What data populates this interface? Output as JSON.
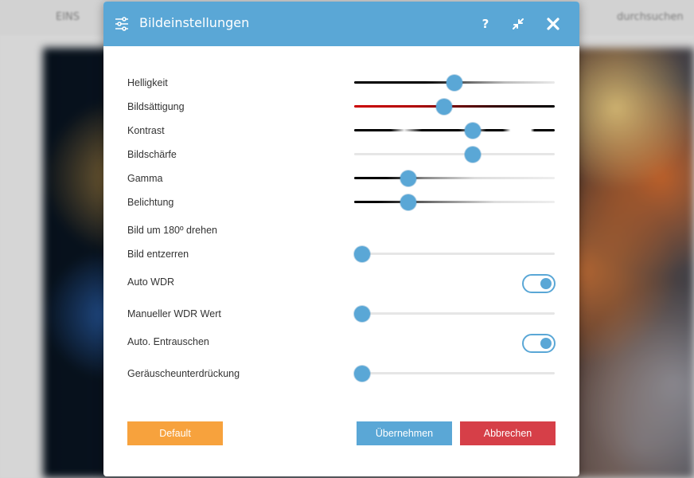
{
  "background": {
    "tab_left": "EINS",
    "tab_right": "durchsuchen"
  },
  "dialog": {
    "title": "Bildeinstellungen",
    "icons": {
      "settings": "sliders-icon",
      "help": "?",
      "collapse": "compress-icon",
      "close": "close-icon"
    },
    "sliders": [
      {
        "label": "Helligkeit",
        "value_fraction": 0.5
      },
      {
        "label": "Bildsättigung",
        "value_fraction": 0.45
      },
      {
        "label": "Kontrast",
        "value_fraction": 0.59
      },
      {
        "label": "Bildschärfe",
        "value_fraction": 0.59
      },
      {
        "label": "Gamma",
        "value_fraction": 0.27
      },
      {
        "label": "Belichtung",
        "value_fraction": 0.27
      }
    ],
    "rotate_label": "Bild um 180º drehen",
    "dewarp": {
      "label": "Bild entzerren",
      "value_fraction": 0.04
    },
    "auto_wdr": {
      "label": "Auto WDR",
      "on": true
    },
    "manual_wdr": {
      "label": "Manueller WDR Wert",
      "value_fraction": 0.04
    },
    "auto_denoise": {
      "label": "Auto. Entrauschen",
      "on": true
    },
    "noise_reduction": {
      "label": "Geräuscheunterdrückung",
      "value_fraction": 0.04
    },
    "buttons": {
      "default": "Default",
      "apply": "Übernehmen",
      "cancel": "Abbrechen"
    },
    "colors": {
      "accent": "#5aa7d6",
      "default_button": "#f7a23d",
      "cancel_button": "#d63f48"
    }
  }
}
